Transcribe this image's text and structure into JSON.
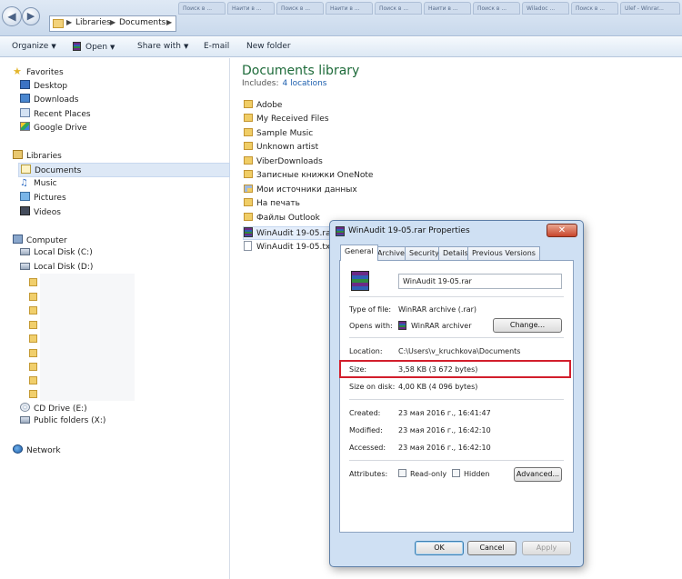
{
  "address": {
    "segments": [
      "Libraries",
      "Documents"
    ]
  },
  "browser_tabs": [
    "Поиск в ...",
    "Наити в ...",
    "Поиск в ...",
    "Наити в ...",
    "Поиск в ...",
    "Наити в ...",
    "Поиск в ...",
    "Wiladoc ...",
    "Поиск в ...",
    "Ulef - Winrar..."
  ],
  "toolbar": {
    "organize": "Organize",
    "open": "Open",
    "share_with": "Share with",
    "email": "E-mail",
    "new_folder": "New folder"
  },
  "nav": {
    "favorites": "Favorites",
    "desktop": "Desktop",
    "downloads": "Downloads",
    "recent_places": "Recent Places",
    "google_drive": "Google Drive",
    "libraries": "Libraries",
    "documents": "Documents",
    "music": "Music",
    "pictures": "Pictures",
    "videos": "Videos",
    "computer": "Computer",
    "local_c": "Local Disk (C:)",
    "local_d": "Local Disk (D:)",
    "cd_drive": "CD Drive (E:)",
    "public_folders": "Public folders (X:)",
    "network": "Network"
  },
  "library": {
    "title": "Documents library",
    "includes_label": "Includes:",
    "includes_link": "4 locations"
  },
  "files": [
    "Adobe",
    "My Received Files",
    "Sample Music",
    "Unknown artist",
    "ViberDownloads",
    "Записные книжки OneNote",
    "Мои источники данных",
    "На печать",
    "Файлы Outlook",
    "WinAudit 19-05.rar",
    "WinAudit 19-05.txt"
  ],
  "dialog": {
    "title": "WinAudit 19-05.rar Properties",
    "close": "✕",
    "tabs": [
      "General",
      "Archive",
      "Security",
      "Details",
      "Previous Versions"
    ],
    "filename": "WinAudit 19-05.rar",
    "type_label": "Type of file:",
    "type_value": "WinRAR archive (.rar)",
    "opens_label": "Opens with:",
    "opens_value": "WinRAR archiver",
    "change_button": "Change...",
    "location_label": "Location:",
    "location_value": "C:\\Users\\v_kruchkova\\Documents",
    "size_label": "Size:",
    "size_value": "3,58 KB (3 672 bytes)",
    "size_on_disk_label": "Size on disk:",
    "size_on_disk_value": "4,00 KB (4 096 bytes)",
    "created_label": "Created:",
    "created_value": "23 мая 2016 г., 16:41:47",
    "modified_label": "Modified:",
    "modified_value": "23 мая 2016 г., 16:42:10",
    "accessed_label": "Accessed:",
    "accessed_value": "23 мая 2016 г., 16:42:10",
    "attributes_label": "Attributes:",
    "readonly_label": "Read-only",
    "hidden_label": "Hidden",
    "advanced_button": "Advanced...",
    "ok": "OK",
    "cancel": "Cancel",
    "apply": "Apply"
  },
  "colors": {
    "highlight_box": "#d21e2c",
    "library_title": "#1e6b3a",
    "link": "#1d5fae"
  }
}
